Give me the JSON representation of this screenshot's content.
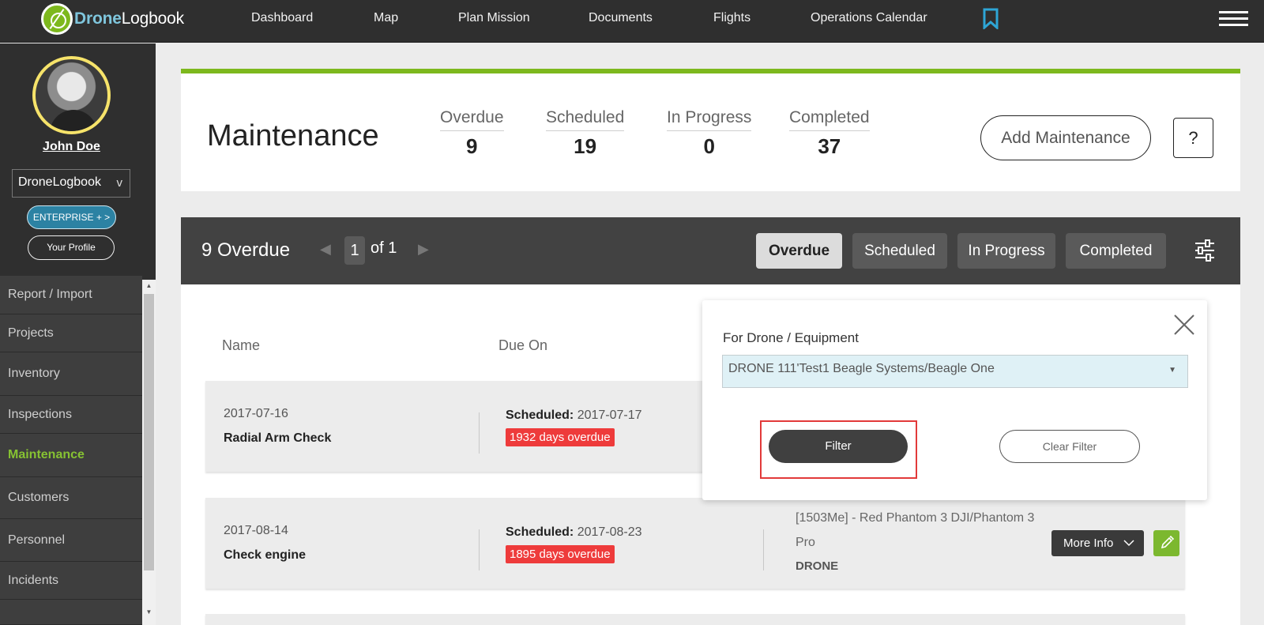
{
  "brand": {
    "name_bold": "Drone",
    "name_rest": "Logbook"
  },
  "nav": [
    "Dashboard",
    "Map",
    "Plan Mission",
    "Documents",
    "Flights",
    "Operations Calendar"
  ],
  "sidebar": {
    "user_name": "John Doe",
    "org_select": "DroneLogbook",
    "org_chevron": "v",
    "enterprise_label": "ENTERPRISE + >",
    "profile_label": "Your Profile",
    "menu": [
      "Report / Import",
      "Projects",
      "Inventory",
      "Inspections",
      "Maintenance",
      "Customers",
      "Personnel",
      "Incidents"
    ],
    "active_item": "Maintenance"
  },
  "summary": {
    "title": "Maintenance",
    "stats": [
      {
        "label": "Overdue",
        "value": "9"
      },
      {
        "label": "Scheduled",
        "value": "19"
      },
      {
        "label": "In Progress",
        "value": "0"
      },
      {
        "label": "Completed",
        "value": "37"
      }
    ],
    "add_label": "Add Maintenance",
    "help_label": "?"
  },
  "list": {
    "count_label": "9 Overdue",
    "page": "1",
    "page_of": "of 1",
    "tabs": [
      "Overdue",
      "Scheduled",
      "In Progress",
      "Completed"
    ],
    "active_tab": "Overdue",
    "columns": [
      "Name",
      "Due On"
    ],
    "rows": [
      {
        "date": "2017-07-16",
        "name": "Radial Arm Check",
        "scheduled_label": "Scheduled:",
        "scheduled_date": "2017-07-17",
        "overdue": "1932 days overdue",
        "equipment": "",
        "equipment_type": ""
      },
      {
        "date": "2017-08-14",
        "name": "Check engine",
        "scheduled_label": "Scheduled:",
        "scheduled_date": "2017-08-23",
        "overdue": "1895 days overdue",
        "equipment": "[1503Me] - Red Phantom 3 DJI/Phantom 3 Pro",
        "equipment_type": "DRONE"
      }
    ],
    "more_info_label": "More Info"
  },
  "filter": {
    "label": "For Drone / Equipment",
    "selected": "DRONE 111'Test1 Beagle Systems/Beagle One",
    "filter_button": "Filter",
    "clear_button": "Clear Filter"
  },
  "colors": {
    "accent_green": "#7db81d",
    "badge_red": "#ee3b3b",
    "dark_bar": "#424242",
    "link_blue": "#2c82a3"
  }
}
